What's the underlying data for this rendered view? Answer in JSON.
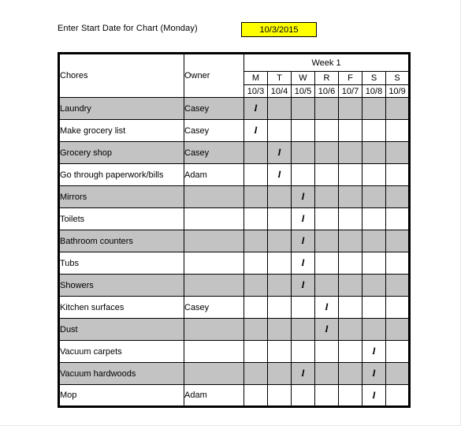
{
  "prompt": {
    "label": "Enter Start Date for Chart (Monday)",
    "start_date": "10/3/2015",
    "highlight_color": "#ffff00"
  },
  "table": {
    "headers": {
      "chores": "Chores",
      "owner": "Owner",
      "week": "Week 1"
    },
    "days": [
      "M",
      "T",
      "W",
      "R",
      "F",
      "S",
      "S"
    ],
    "dates": [
      "10/3",
      "10/4",
      "10/5",
      "10/6",
      "10/7",
      "10/8",
      "10/9"
    ],
    "mark_glyph": "l",
    "shade_color": "#c3c3c3",
    "rows": [
      {
        "chore": "Laundry",
        "owner": "Casey",
        "marks": [
          true,
          false,
          false,
          false,
          false,
          false,
          false
        ]
      },
      {
        "chore": "Make grocery list",
        "owner": "Casey",
        "marks": [
          true,
          false,
          false,
          false,
          false,
          false,
          false
        ]
      },
      {
        "chore": "Grocery shop",
        "owner": "Casey",
        "marks": [
          false,
          true,
          false,
          false,
          false,
          false,
          false
        ]
      },
      {
        "chore": "Go through paperwork/bills",
        "owner": "Adam",
        "marks": [
          false,
          true,
          false,
          false,
          false,
          false,
          false
        ]
      },
      {
        "chore": "Mirrors",
        "owner": "",
        "marks": [
          false,
          false,
          true,
          false,
          false,
          false,
          false
        ]
      },
      {
        "chore": "Toilets",
        "owner": "",
        "marks": [
          false,
          false,
          true,
          false,
          false,
          false,
          false
        ]
      },
      {
        "chore": "Bathroom counters",
        "owner": "",
        "marks": [
          false,
          false,
          true,
          false,
          false,
          false,
          false
        ]
      },
      {
        "chore": "Tubs",
        "owner": "",
        "marks": [
          false,
          false,
          true,
          false,
          false,
          false,
          false
        ]
      },
      {
        "chore": "Showers",
        "owner": "",
        "marks": [
          false,
          false,
          true,
          false,
          false,
          false,
          false
        ]
      },
      {
        "chore": "Kitchen surfaces",
        "owner": "Casey",
        "marks": [
          false,
          false,
          false,
          true,
          false,
          false,
          false
        ]
      },
      {
        "chore": "Dust",
        "owner": "",
        "marks": [
          false,
          false,
          false,
          true,
          false,
          false,
          false
        ]
      },
      {
        "chore": "Vacuum carpets",
        "owner": "",
        "marks": [
          false,
          false,
          false,
          false,
          false,
          true,
          false
        ]
      },
      {
        "chore": "Vacuum hardwoods",
        "owner": "",
        "marks": [
          false,
          false,
          true,
          false,
          false,
          true,
          false
        ]
      },
      {
        "chore": "Mop",
        "owner": "Adam",
        "marks": [
          false,
          false,
          false,
          false,
          false,
          true,
          false
        ]
      }
    ]
  }
}
